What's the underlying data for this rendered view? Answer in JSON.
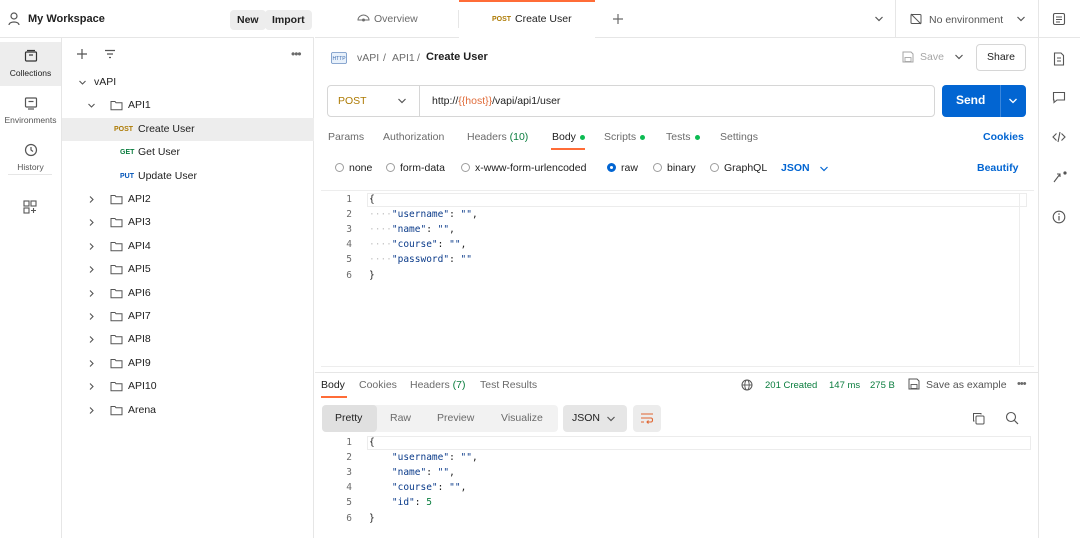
{
  "workspace": {
    "title": "My Workspace",
    "new_label": "New",
    "import_label": "Import"
  },
  "rail": [
    {
      "label": "Collections",
      "icon": "collections-icon"
    },
    {
      "label": "Environments",
      "icon": "environments-icon"
    },
    {
      "label": "History",
      "icon": "history-icon"
    }
  ],
  "tree": {
    "root": "vAPI",
    "api1": "API1",
    "requests": [
      {
        "method": "POST",
        "name": "Create User"
      },
      {
        "method": "GET",
        "name": "Get User"
      },
      {
        "method": "PUT",
        "name": "Update User"
      }
    ],
    "folders": [
      "API2",
      "API3",
      "API4",
      "API5",
      "API6",
      "API7",
      "API8",
      "API9",
      "API10",
      "Arena"
    ]
  },
  "tabs": {
    "overview": "Overview",
    "active_method": "POST",
    "active_name": "Create User",
    "environment": "No environment"
  },
  "breadcrumb": {
    "part1": "vAPI",
    "part2": "API1",
    "current": "Create User",
    "save": "Save",
    "share": "Share"
  },
  "request": {
    "method": "POST",
    "url_prefix": "http://",
    "url_var": "{{host}}",
    "url_suffix": "/vapi/api1/user",
    "send": "Send"
  },
  "request_tabs": {
    "params": "Params",
    "authorization": "Authorization",
    "headers": "Headers",
    "headers_count": "(10)",
    "body": "Body",
    "scripts": "Scripts",
    "tests": "Tests",
    "settings": "Settings",
    "cookies": "Cookies"
  },
  "body_types": {
    "none": "none",
    "form_data": "form-data",
    "urlencoded": "x-www-form-urlencoded",
    "raw": "raw",
    "binary": "binary",
    "graphql": "GraphQL",
    "format": "JSON",
    "beautify": "Beautify"
  },
  "request_body": {
    "line_numbers": [
      "1",
      "2",
      "3",
      "4",
      "5",
      "6"
    ],
    "open": "{",
    "close": "}",
    "lines": [
      {
        "key": "\"username\"",
        "value": "\"\"",
        "comma": ","
      },
      {
        "key": "\"name\"",
        "value": "\"\"",
        "comma": ","
      },
      {
        "key": "\"course\"",
        "value": "\"\"",
        "comma": ","
      },
      {
        "key": "\"password\"",
        "value": "\"\"",
        "comma": ""
      }
    ]
  },
  "response_tabs": {
    "body": "Body",
    "cookies": "Cookies",
    "headers": "Headers",
    "headers_count": "(7)",
    "test_results": "Test Results",
    "status": "201 Created",
    "time": "147 ms",
    "size": "275 B",
    "save_example": "Save as example"
  },
  "response_view": {
    "pretty": "Pretty",
    "raw": "Raw",
    "preview": "Preview",
    "visualize": "Visualize",
    "format": "JSON"
  },
  "response_body": {
    "line_numbers": [
      "1",
      "2",
      "3",
      "4",
      "5",
      "6"
    ],
    "open": "{",
    "close": "}",
    "lines": [
      {
        "key": "\"username\"",
        "value": "\"\"",
        "comma": ","
      },
      {
        "key": "\"name\"",
        "value": "\"\"",
        "comma": ","
      },
      {
        "key": "\"course\"",
        "value": "\"\"",
        "comma": ","
      },
      {
        "key": "\"id\"",
        "value": "5",
        "comma": ""
      }
    ]
  },
  "colors": {
    "accent": "#ff6c37",
    "send": "#0265d2",
    "post": "#ad7a03",
    "get": "#0a7d3e",
    "put": "#0053b8",
    "success": "#0cbb52"
  }
}
